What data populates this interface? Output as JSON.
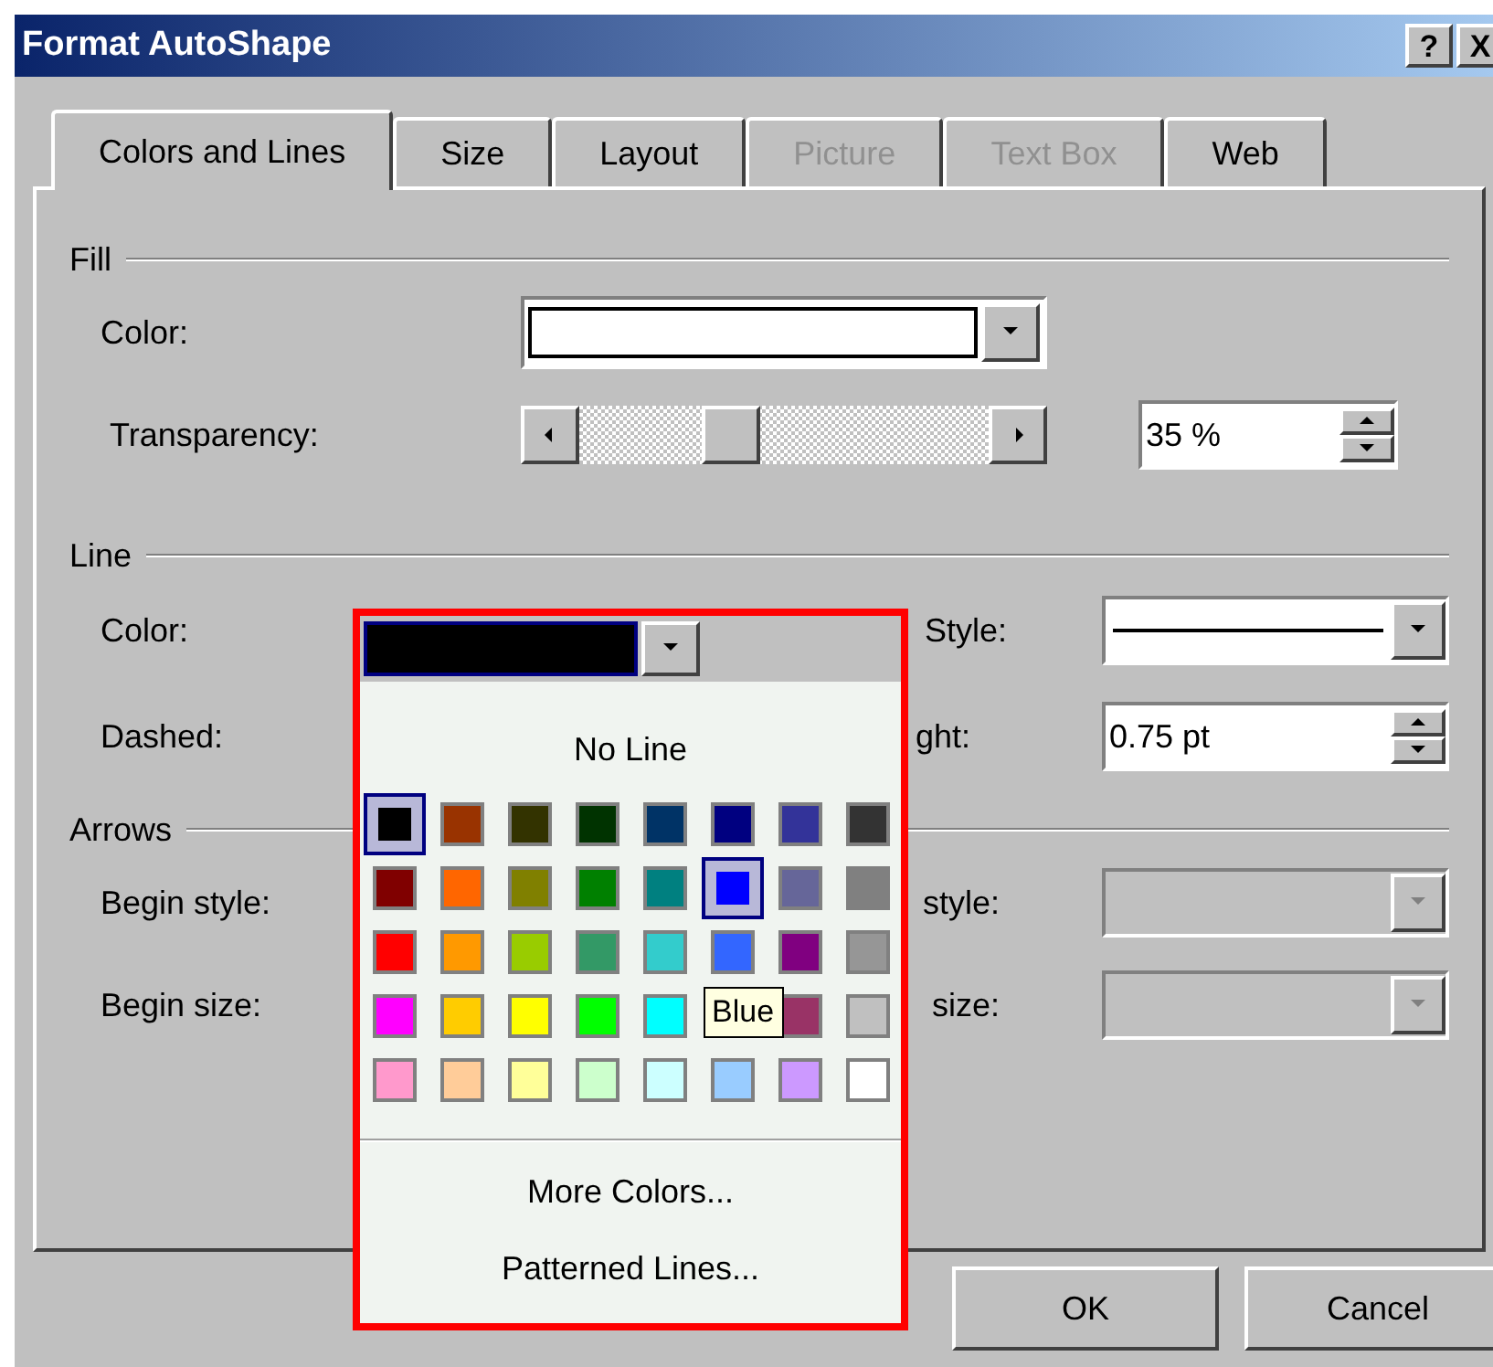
{
  "window": {
    "title": "Format AutoShape",
    "controls": [
      "?",
      "X"
    ]
  },
  "tabs": [
    {
      "label": "Colors and Lines",
      "selected": true,
      "disabled": false
    },
    {
      "label": "Size",
      "selected": false,
      "disabled": false
    },
    {
      "label": "Layout",
      "selected": false,
      "disabled": false
    },
    {
      "label": "Picture",
      "selected": false,
      "disabled": true
    },
    {
      "label": "Text Box",
      "selected": false,
      "disabled": true
    },
    {
      "label": "Web",
      "selected": false,
      "disabled": false
    }
  ],
  "fill": {
    "heading": "Fill",
    "color_label": "Color:",
    "transparency_label": "Transparency:",
    "transparency": {
      "level": 0.35,
      "value": "35 %"
    }
  },
  "line": {
    "heading": "Line",
    "color_label": "Color:",
    "style_label": "Style:",
    "dashed_label": "Dashed:",
    "weight_label": "ght:",
    "weight_value": "0.75 pt"
  },
  "arrows": {
    "heading": "Arrows",
    "rows": [
      {
        "label": "Begin style:",
        "right_label": "style:",
        "disabled": true
      },
      {
        "label": "Begin size:",
        "right_label": "size:",
        "disabled": true
      }
    ]
  },
  "color_menu": {
    "no_line": "No Line",
    "swatches": [
      {
        "color": "#000000",
        "selected": true
      },
      {
        "color": "#993300",
        "selected": false
      },
      {
        "color": "#333300",
        "selected": false
      },
      {
        "color": "#003300",
        "selected": false
      },
      {
        "color": "#003366",
        "selected": false
      },
      {
        "color": "#000080",
        "selected": false
      },
      {
        "color": "#333399",
        "selected": false
      },
      {
        "color": "#333333",
        "selected": false
      },
      {
        "color": "#800000",
        "selected": false
      },
      {
        "color": "#ff6600",
        "selected": false
      },
      {
        "color": "#808000",
        "selected": false
      },
      {
        "color": "#008000",
        "selected": false
      },
      {
        "color": "#008080",
        "selected": false
      },
      {
        "color": "#0000ff",
        "selected": true
      },
      {
        "color": "#666699",
        "selected": false
      },
      {
        "color": "#808080",
        "selected": false
      },
      {
        "color": "#ff0000",
        "selected": false
      },
      {
        "color": "#ff9900",
        "selected": false
      },
      {
        "color": "#99cc00",
        "selected": false
      },
      {
        "color": "#339966",
        "selected": false
      },
      {
        "color": "#33cccc",
        "selected": false
      },
      {
        "color": "#3366ff",
        "selected": false
      },
      {
        "color": "#800080",
        "selected": false
      },
      {
        "color": "#969696",
        "selected": false
      },
      {
        "color": "#ff00ff",
        "selected": false
      },
      {
        "color": "#ffcc00",
        "selected": false
      },
      {
        "color": "#ffff00",
        "selected": false
      },
      {
        "color": "#00ff00",
        "selected": false
      },
      {
        "color": "#00ffff",
        "selected": false
      },
      {
        "kind": "tooltip",
        "text": "Blue"
      },
      {
        "color": "#993366",
        "selected": false
      },
      {
        "color": "#c0c0c0",
        "selected": false
      },
      {
        "color": "#ff99cc",
        "selected": false
      },
      {
        "color": "#ffcc99",
        "selected": false
      },
      {
        "color": "#ffff99",
        "selected": false
      },
      {
        "color": "#ccffcc",
        "selected": false
      },
      {
        "color": "#ccffff",
        "selected": false
      },
      {
        "color": "#99ccff",
        "selected": false
      },
      {
        "color": "#cc99ff",
        "selected": false
      },
      {
        "color": "#ffffff",
        "selected": false
      }
    ],
    "items": [
      "More Colors...",
      "Patterned Lines..."
    ]
  },
  "buttons": [
    "OK",
    "Cancel"
  ]
}
